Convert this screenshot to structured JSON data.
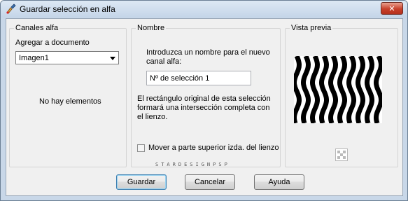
{
  "window": {
    "title": "Guardar selección en alfa",
    "close_label": "✕"
  },
  "canales": {
    "group_label": "Canales alfa",
    "agregar_label": "Agregar a documento",
    "document_select": "Imagen1",
    "empty_text": "No hay elementos"
  },
  "nombre": {
    "group_label": "Nombre",
    "prompt": "Introduzca un nombre para el nuevo canal alfa:",
    "input_value": "Nº de selección 1",
    "info": "El rectángulo original de esta selección formará una intersección completa con el lienzo.",
    "checkbox_label": "Mover a parte superior izda. del lienzo",
    "checkbox_checked": false
  },
  "vista": {
    "group_label": "Vista previa"
  },
  "watermark": "STARDESIGNPSP",
  "buttons": {
    "guardar": "Guardar",
    "cancelar": "Cancelar",
    "ayuda": "Ayuda"
  },
  "colors": {
    "titlebar": "#c4d5e8",
    "dialog_bg": "#f0f0f0",
    "close": "#c7402a"
  },
  "icons": {
    "app": "paint-brush-icon",
    "preview_toggle": "checkerboard-icon"
  }
}
